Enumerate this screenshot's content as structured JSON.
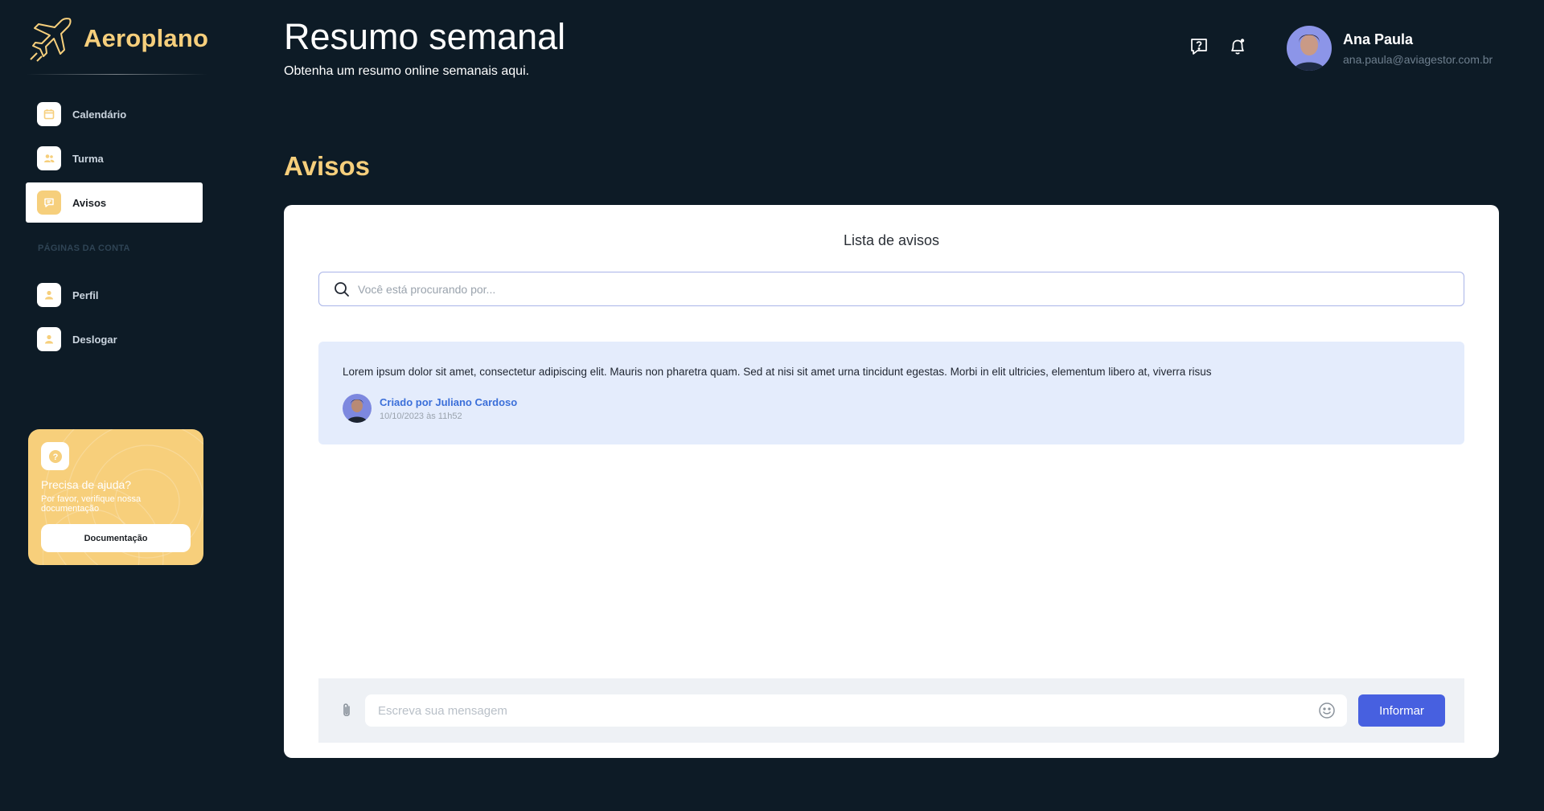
{
  "brand": {
    "name": "Aeroplano"
  },
  "sidebar": {
    "items": [
      {
        "label": "Calendário",
        "icon": "calendar-icon"
      },
      {
        "label": "Turma",
        "icon": "users-icon"
      },
      {
        "label": "Avisos",
        "icon": "message-icon",
        "active": true
      }
    ],
    "section_title": "PÁGINAS DA CONTA",
    "account_items": [
      {
        "label": "Perfil",
        "icon": "user-icon"
      },
      {
        "label": "Deslogar",
        "icon": "user-icon"
      }
    ]
  },
  "help_card": {
    "title": "Precisa de ajuda?",
    "subtitle": "Por favor, verifique nossa documentação",
    "button_label": "Documentação"
  },
  "header": {
    "title": "Resumo semanal",
    "subtitle": "Obtenha um resumo online semanais aqui."
  },
  "user": {
    "name": "Ana Paula",
    "email": "ana.paula@aviagestor.com.br"
  },
  "main": {
    "section_title": "Avisos",
    "list_title": "Lista de avisos",
    "search_placeholder": "Você está procurando por...",
    "notices": [
      {
        "text": "Lorem ipsum dolor sit amet, consectetur adipiscing elit. Mauris non pharetra quam. Sed at nisi sit amet urna tincidunt egestas. Morbi in elit ultricies, elementum libero at, viverra risus",
        "author": "Criado por Juliano Cardoso",
        "date": "10/10/2023 às 11h52"
      }
    ],
    "composer": {
      "placeholder": "Escreva sua mensagem",
      "send_label": "Informar"
    }
  },
  "colors": {
    "background": "#0d1b26",
    "accent": "#f6cf7c",
    "primary": "#4760e0",
    "notice_bg": "#e4ecfc"
  }
}
